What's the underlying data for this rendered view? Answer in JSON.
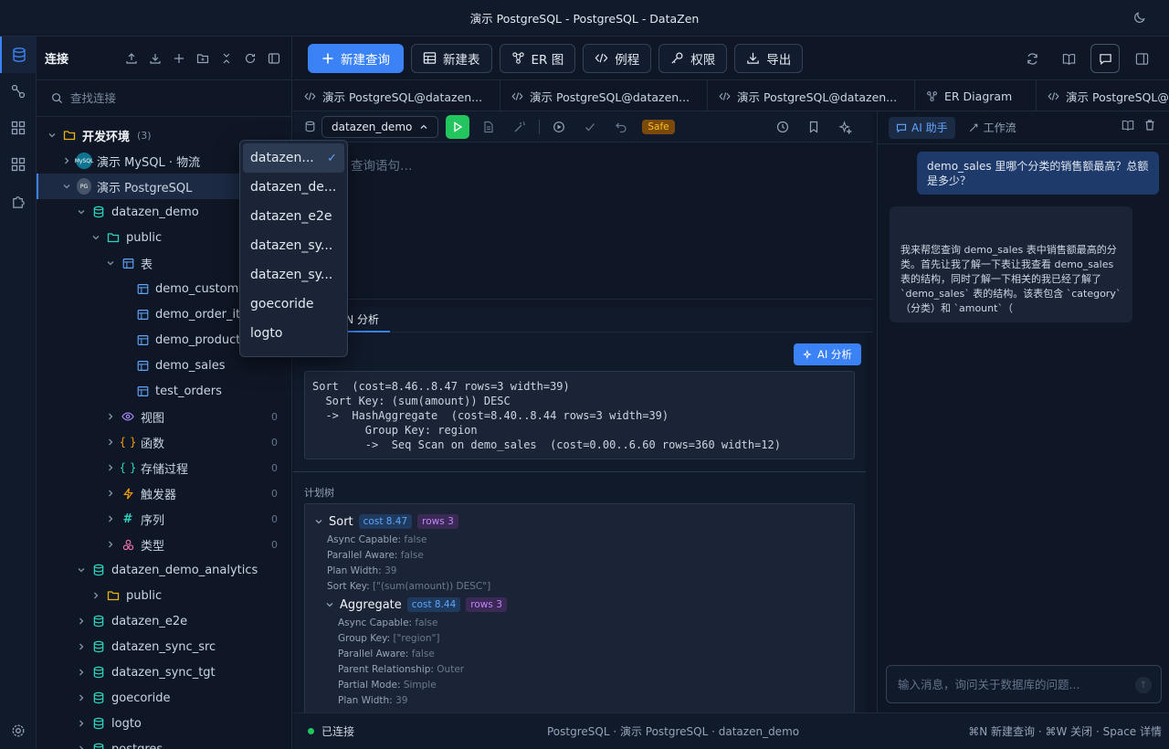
{
  "window": {
    "title": "演示 PostgreSQL - PostgreSQL - DataZen"
  },
  "sidebar": {
    "header_label": "连接",
    "search_placeholder": "查找连接",
    "tree": [
      {
        "label": "开发环境",
        "sub": "(3)",
        "level": 0,
        "chev": "v",
        "icon": "folder-icon"
      },
      {
        "label": "演示 MySQL · 物流",
        "level": 1,
        "chev": ">",
        "icon": "mysql-icon"
      },
      {
        "label": "演示 PostgreSQL",
        "level": 1,
        "chev": "v",
        "icon": "postgresql-icon",
        "selected": true
      },
      {
        "label": "datazen_demo",
        "level": 2,
        "chev": "v",
        "icon": "database-icon"
      },
      {
        "label": "public",
        "level": 3,
        "chev": "v",
        "icon": "folder-open-icon"
      },
      {
        "label": "表",
        "level": 4,
        "chev": "v",
        "icon": "table-icon"
      },
      {
        "label": "demo_customers",
        "level": 5,
        "icon": "table-icon"
      },
      {
        "label": "demo_order_items",
        "level": 5,
        "icon": "table-icon"
      },
      {
        "label": "demo_products",
        "level": 5,
        "icon": "table-icon"
      },
      {
        "label": "demo_sales",
        "level": 5,
        "icon": "table-icon"
      },
      {
        "label": "test_orders",
        "level": 5,
        "icon": "table-icon"
      },
      {
        "label": "视图",
        "level": 4,
        "chev": ">",
        "icon": "eye-icon",
        "count": "0"
      },
      {
        "label": "函数",
        "level": 4,
        "chev": ">",
        "icon": "braces-icon",
        "count": "0"
      },
      {
        "label": "存储过程",
        "level": 4,
        "chev": ">",
        "icon": "braces-green-icon",
        "count": "0"
      },
      {
        "label": "触发器",
        "level": 4,
        "chev": ">",
        "icon": "bolt-icon",
        "count": "0"
      },
      {
        "label": "序列",
        "level": 4,
        "chev": ">",
        "icon": "hash-icon",
        "count": "0"
      },
      {
        "label": "类型",
        "level": 4,
        "chev": ">",
        "icon": "shapes-icon",
        "count": "0"
      },
      {
        "label": "datazen_demo_analytics",
        "level": 2,
        "chev": "v",
        "icon": "database-icon"
      },
      {
        "label": "public",
        "level": 3,
        "chev": ">",
        "icon": "folder-icon"
      },
      {
        "label": "datazen_e2e",
        "level": 2,
        "chev": ">",
        "icon": "database-icon"
      },
      {
        "label": "datazen_sync_src",
        "level": 2,
        "chev": ">",
        "icon": "database-icon"
      },
      {
        "label": "datazen_sync_tgt",
        "level": 2,
        "chev": ">",
        "icon": "database-icon"
      },
      {
        "label": "goecoride",
        "level": 2,
        "chev": ">",
        "icon": "database-icon"
      },
      {
        "label": "logto",
        "level": 2,
        "chev": ">",
        "icon": "database-icon"
      },
      {
        "label": "postgres",
        "level": 2,
        "chev": ">",
        "icon": "database-icon"
      }
    ]
  },
  "dropdown": {
    "items": [
      "datazen...",
      "datazen_de...",
      "datazen_e2e",
      "datazen_sy...",
      "datazen_sy...",
      "goecoride",
      "logto"
    ],
    "selected_index": 0
  },
  "toolbar": {
    "new_query": "新建查询",
    "new_table": "新建表",
    "er_diagram": "ER 图",
    "routines": "例程",
    "permissions": "权限",
    "export": "导出"
  },
  "tabs": [
    "演示 PostgreSQL@datazen...",
    "演示 PostgreSQL@datazen...",
    "演示 PostgreSQL@datazen...",
    "ER Diagram",
    "演示 PostgreSQL@da"
  ],
  "editor": {
    "database": "datazen_demo",
    "safe_badge": "Safe",
    "placeholder": "SQL 查询语句…"
  },
  "results": {
    "tab_label": "N 分析",
    "ai_analyze": "AI 分析",
    "plan_text": "Sort  (cost=8.46..8.47 rows=3 width=39)\n  Sort Key: (sum(amount)) DESC\n  ->  HashAggregate  (cost=8.40..8.44 rows=3 width=39)\n        Group Key: region\n        ->  Seq Scan on demo_sales  (cost=0.00..6.60 rows=360 width=12)",
    "plan_tree_label": "计划树",
    "nodes": [
      {
        "name": "Sort",
        "cost": "cost 8.47",
        "rows": "rows 3",
        "props": [
          [
            "Async Capable: ",
            "false"
          ],
          [
            "Parallel Aware: ",
            "false"
          ],
          [
            "Plan Width: ",
            "39"
          ],
          [
            "Sort Key: ",
            "[\"(sum(amount)) DESC\"]"
          ]
        ]
      },
      {
        "name": "Aggregate",
        "cost": "cost 8.44",
        "rows": "rows 3",
        "props": [
          [
            "Async Capable: ",
            "false"
          ],
          [
            "Group Key: ",
            "[\"region\"]"
          ],
          [
            "Parallel Aware: ",
            "false"
          ],
          [
            "Parent Relationship: ",
            "Outer"
          ],
          [
            "Partial Mode: ",
            "Simple"
          ],
          [
            "Plan Width: ",
            "39"
          ]
        ]
      }
    ]
  },
  "ai": {
    "tab_assistant": "AI 助手",
    "tab_workflow": "工作流",
    "user_message": "demo_sales 里哪个分类的销售额最高？总额是多少？",
    "ai_message": "我来帮您查询 demo_sales 表中销售额最高的分类。首先让我了解一下表让我查看 demo_sales 表的结构，同时了解一下相关的我已经了解了 `demo_sales` 表的结构。该表包含 `category`（分类）和 `amount`（",
    "input_placeholder": "输入消息，询问关于数据库的问题..."
  },
  "status": {
    "connected": "已连接",
    "context": "PostgreSQL · 演示 PostgreSQL · datazen_demo",
    "shortcuts": "⌘N 新建查询 · ⌘W 关闭 · Space 详情"
  },
  "colors": {
    "accent": "#3b82f6",
    "success": "#22c55e",
    "warning": "#fbbf24"
  }
}
